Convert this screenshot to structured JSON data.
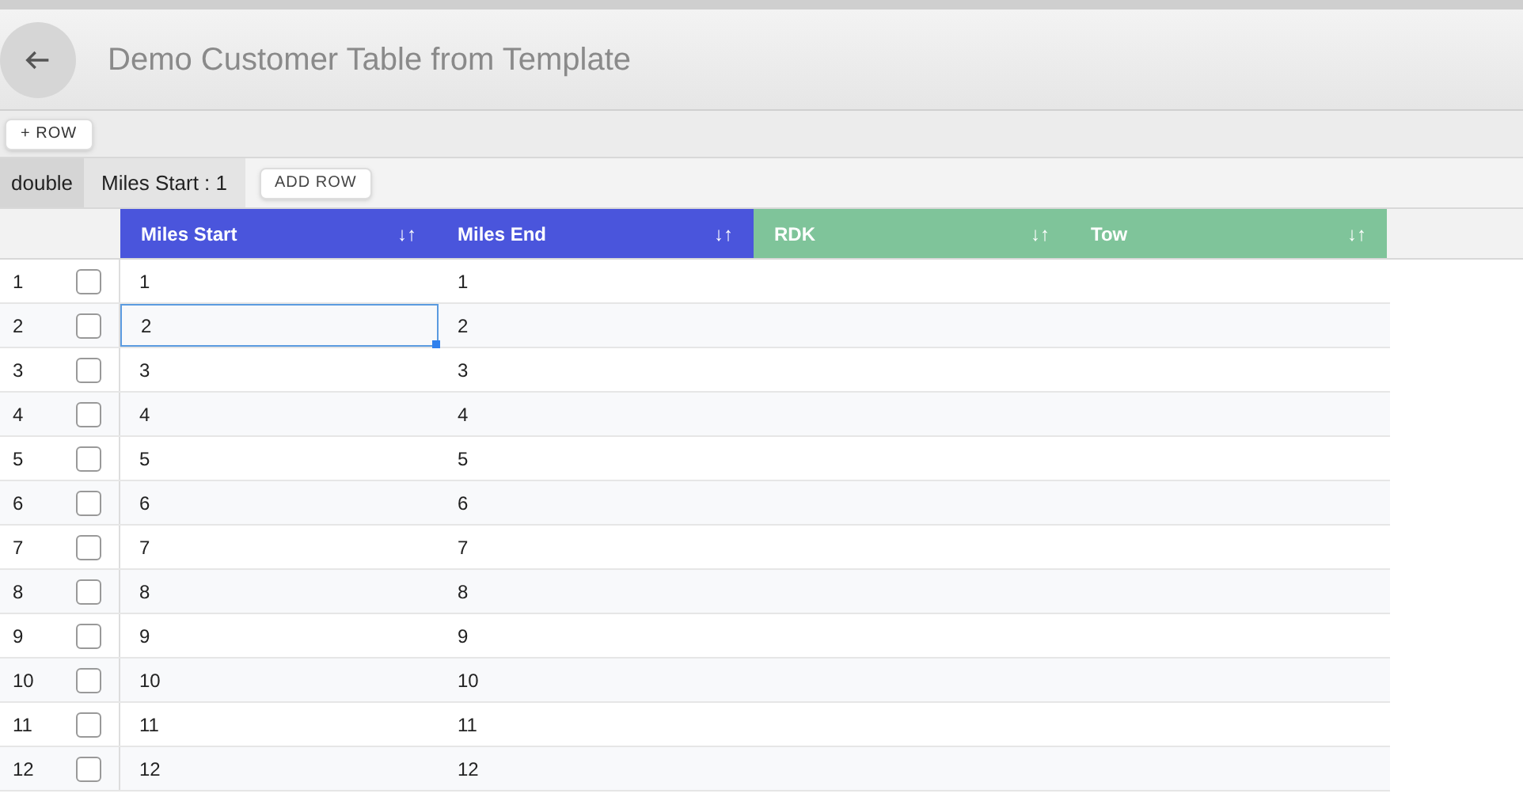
{
  "header": {
    "title": "Demo Customer Table from Template"
  },
  "toolbar": {
    "add_button": "+ ROW"
  },
  "group_bar": {
    "chip": "double",
    "filter": "Miles Start : 1",
    "add_button": "ADD ROW"
  },
  "table": {
    "columns": [
      {
        "label": "Miles Start",
        "sort": "↓↑",
        "color": "#4a55dc"
      },
      {
        "label": "Miles End",
        "sort": "↓↑",
        "color": "#4a55dc"
      },
      {
        "label": "RDK",
        "sort": "↓↑",
        "color": "#7fc49a"
      },
      {
        "label": "Tow",
        "sort": "↓↑",
        "color": "#7fc49a"
      }
    ],
    "rows": [
      {
        "number": "1",
        "checked": false,
        "cells": [
          "1",
          "1"
        ],
        "selected": false
      },
      {
        "number": "2",
        "checked": false,
        "cells": [
          "2",
          "2"
        ],
        "selected": true
      },
      {
        "number": "3",
        "checked": false,
        "cells": [
          "3",
          "3"
        ],
        "selected": false
      },
      {
        "number": "4",
        "checked": false,
        "cells": [
          "4",
          "4"
        ],
        "selected": false
      },
      {
        "number": "5",
        "checked": false,
        "cells": [
          "5",
          "5"
        ],
        "selected": false
      },
      {
        "number": "6",
        "checked": false,
        "cells": [
          "6",
          "6"
        ],
        "selected": false
      },
      {
        "number": "7",
        "checked": false,
        "cells": [
          "7",
          "7"
        ],
        "selected": false
      },
      {
        "number": "8",
        "checked": false,
        "cells": [
          "8",
          "8"
        ],
        "selected": false
      },
      {
        "number": "9",
        "checked": false,
        "cells": [
          "9",
          "9"
        ],
        "selected": false
      },
      {
        "number": "10",
        "checked": false,
        "cells": [
          "10",
          "10"
        ],
        "selected": false
      },
      {
        "number": "11",
        "checked": false,
        "cells": [
          "11",
          "11"
        ],
        "selected": false
      },
      {
        "number": "12",
        "checked": false,
        "cells": [
          "12",
          "12"
        ],
        "selected": false
      }
    ]
  }
}
